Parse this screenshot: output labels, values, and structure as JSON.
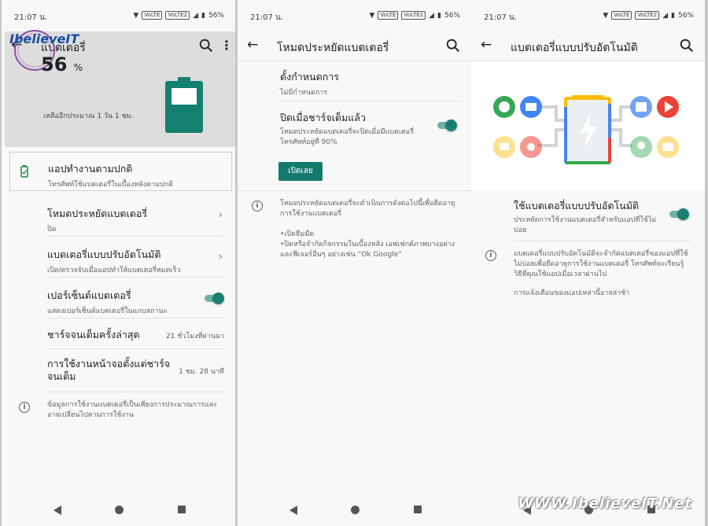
{
  "status": {
    "time1": "21:07 น.",
    "time2": "21:07 น.",
    "time3": "21:07 น.",
    "battery": "56%",
    "volte": "VoLTE",
    "volte2": "VoLTE2"
  },
  "screen1": {
    "title": "แบตเตอรี่",
    "percent": "56",
    "percent_sign": "%",
    "remaining": "เหลืออีกประมาณ 1 วัน 1 ชม.",
    "normal_title": "แอปทำงานตามปกติ",
    "normal_sub": "โทรศัพท์ใช้แบตเตอรี่ในเบื้องหลังตามปกติ",
    "saver_title": "โหมดประหยัดแบตเตอรี่",
    "saver_sub": "ปิด",
    "adaptive_title": "แบตเตอรี่แบบปรับอัตโนมัติ",
    "adaptive_sub": "เปิด/ตรวจจับเมื่อแอปทำให้แบตเตอรี่หมดเร็ว",
    "percent_title": "เปอร์เซ็นต์แบตเตอรี่",
    "percent_sub": "แสดงเปอร์เซ็นต์แบตเตอรี่ในแถบสถานะ",
    "lastfull_title": "ชาร์จจนเต็มครั้งล่าสุด",
    "lastfull_value": "21 ชั่วโมงที่ผ่านมา",
    "screen_title": "การใช้งานหน้าจอตั้งแต่ชาร์จจนเต็ม",
    "screen_value": "1 ชม. 28 นาที",
    "info": "ข้อมูลการใช้งานแบตเตอรี่เป็นเพียงการประมาณการและอาจเปลี่ยนไปตามการใช้งาน"
  },
  "screen2": {
    "title": "โหมดประหยัดแบตเตอรี่",
    "schedule_title": "ตั้งกำหนดการ",
    "schedule_sub": "ไม่มีกำหนดการ",
    "off_full_title": "ปิดเมื่อชาร์จเต็มแล้ว",
    "off_full_sub": "โหมดประหยัดแบตเตอรี่จะปิดเมื่อมีแบตเตอรี่โทรศัพท์อยู่ที่ 90%",
    "button": "เปิดเลย",
    "info1": "โหมดประหยัดแบตเตอรี่จะดำเนินการดังต่อไปนี้เพื่อยืดอายุการใช้งานแบตเตอรี่",
    "info2": "•เปิดธีมมืด",
    "info3": "•ปิดหรือจำกัดกิจกรรมในเบื้องหลัง เอฟเฟกต์ภาพบางอย่าง และฟีเจอร์อื่นๆ อย่างเช่น “Ok Google”"
  },
  "screen3": {
    "title": "แบตเตอรี่แบบปรับอัตโนมัติ",
    "use_title": "ใช้แบตเตอรี่แบบปรับอัตโนมัติ",
    "use_sub": "ประหยัดการใช้งานแบตเตอรี่สำหรับแอปที่ใช้ไม่บ่อย",
    "info1": "แบตเตอรี่แบบปรับอัตโนมัติจะจำกัดแบตเตอรี่ของแอปที่ใช้ไม่บ่อยเพื่อยืดอายุการใช้งานแบตเตอรี่ โทรศัพท์จะเรียนรู้วิธีที่คุณใช้แอปเมื่อเวลาผ่านไป",
    "info2": "การแจ้งเตือนของแอปเหล่านี้อาจล่าช้า"
  },
  "logo_text": "IbelieveIT",
  "watermark": "WWW.IbelieveIT.Net",
  "colors": {
    "accent": "#1a7f72",
    "toggle_track": "#6fb3aa",
    "hero_bg": "#dddddd"
  },
  "toggles": {
    "percent_on": true,
    "off_full_on": true,
    "adaptive_on": true
  }
}
